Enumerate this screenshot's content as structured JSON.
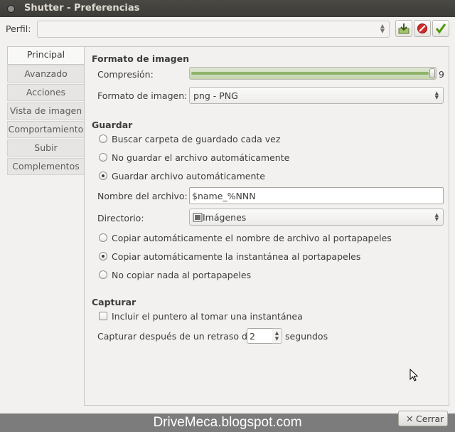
{
  "window": {
    "title": "Shutter - Preferencias"
  },
  "profile": {
    "label": "Perfil:",
    "value": ""
  },
  "tabs": [
    {
      "label": "Principal"
    },
    {
      "label": "Avanzado"
    },
    {
      "label": "Acciones"
    },
    {
      "label": "Vista de imagen"
    },
    {
      "label": "Comportamiento"
    },
    {
      "label": "Subir"
    },
    {
      "label": "Complementos"
    }
  ],
  "active_tab": "Principal",
  "image_format": {
    "section": "Formato de imagen",
    "compression_label": "Compresión:",
    "compression_value": "9",
    "format_label": "Formato de imagen:",
    "format_value": "png - PNG"
  },
  "save": {
    "section": "Guardar",
    "radio1": "Buscar carpeta de guardado cada vez",
    "radio2": "No guardar el archivo automáticamente",
    "radio3": "Guardar archivo automáticamente",
    "selected_radio": 3,
    "filename_label": "Nombre del archivo:",
    "filename_value": "$name_%NNN",
    "directory_label": "Directorio:",
    "directory_value": "Imágenes",
    "clip1": "Copiar automáticamente el nombre de archivo al portapapeles",
    "clip2": "Copiar automáticamente la instantánea al portapapeles",
    "clip3": "No copiar nada al portapapeles",
    "selected_clip": 2
  },
  "capture": {
    "section": "Capturar",
    "include_pointer": "Incluir el puntero al tomar una instantánea",
    "include_pointer_checked": false,
    "delay_label": "Capturar después de un retraso de",
    "delay_value": "2",
    "delay_unit": "segundos"
  },
  "footer": {
    "watermark": "DriveMeca.blogspot.com",
    "close_label": "Cerrar"
  },
  "colors": {
    "accent_green": "#8fb36a",
    "titlebar": "#3c3b37",
    "footer_band": "#7c7c7c"
  }
}
